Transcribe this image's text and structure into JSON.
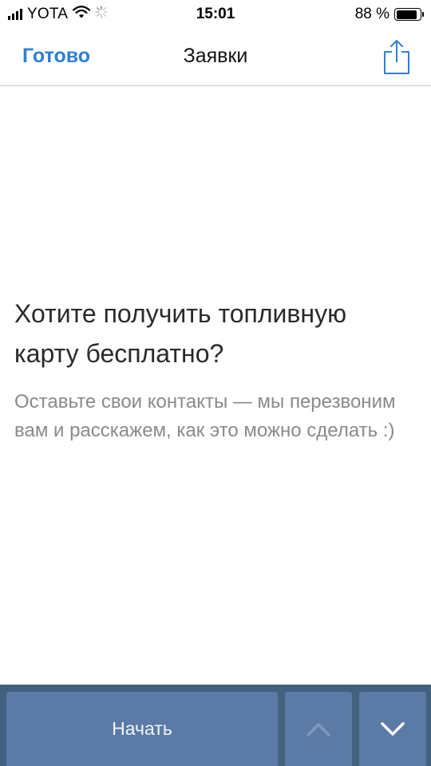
{
  "status_bar": {
    "carrier": "YOTA",
    "time": "15:01",
    "battery_text": "88 %",
    "battery_level": 0.88,
    "icons": [
      "signal-icon",
      "wifi-icon",
      "activity-spinner-icon",
      "battery-icon"
    ]
  },
  "nav": {
    "done_label": "Готово",
    "title": "Заявки",
    "share_icon": "share-icon"
  },
  "content": {
    "headline": "Хотите получить топливную карту бесплатно?",
    "subtitle": "Оставьте свои контакты — мы перезвоним вам и расскажем, как это можно сделать :)"
  },
  "toolbar": {
    "start_label": "Начать",
    "up_icon": "chevron-up-icon",
    "down_icon": "chevron-down-icon"
  },
  "colors": {
    "accent": "#2e7fd6",
    "toolbar_bg": "#44607f",
    "button_bg": "#5b7aa5",
    "headline_text": "#2a2a2a",
    "subtitle_text": "#8a8a8a"
  }
}
